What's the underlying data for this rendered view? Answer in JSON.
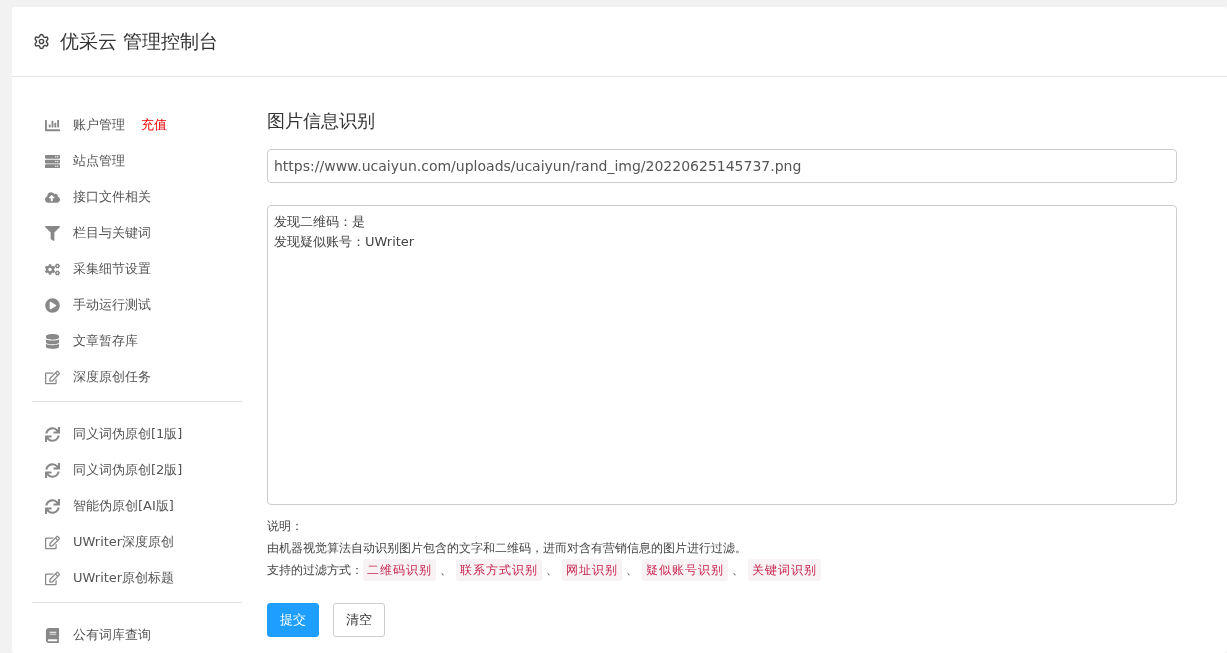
{
  "header": {
    "title": "优采云 管理控制台"
  },
  "sidebar": {
    "groups": [
      {
        "items": [
          {
            "kind": "chart",
            "label": "账户管理",
            "badge": "充值"
          },
          {
            "kind": "server",
            "label": "站点管理"
          },
          {
            "kind": "cloud",
            "label": "接口文件相关"
          },
          {
            "kind": "filter",
            "label": "栏目与关键词"
          },
          {
            "kind": "cogs",
            "label": "采集细节设置"
          },
          {
            "kind": "play",
            "label": "手动运行测试"
          },
          {
            "kind": "database",
            "label": "文章暂存库"
          },
          {
            "kind": "edit",
            "label": "深度原创任务"
          }
        ]
      },
      {
        "items": [
          {
            "kind": "sync",
            "label": "同义词伪原创[1版]"
          },
          {
            "kind": "sync",
            "label": "同义词伪原创[2版]"
          },
          {
            "kind": "sync",
            "label": "智能伪原创[AI版]"
          },
          {
            "kind": "edit",
            "label": "UWriter深度原创"
          },
          {
            "kind": "edit",
            "label": "UWriter原创标题"
          }
        ]
      },
      {
        "items": [
          {
            "kind": "book",
            "label": "公有词库查询"
          }
        ]
      }
    ]
  },
  "main": {
    "title": "图片信息识别",
    "url_field": {
      "value": "https://www.ucaiyun.com/uploads/ucaiyun/rand_img/20220625145737.png"
    },
    "result_box": {
      "lines": [
        "发现二维码：是",
        "发现疑似账号：UWriter"
      ]
    },
    "note_label": "说明：",
    "note_text": "由机器视觉算法自动识别图片包含的文字和二维码，进而对含有营销信息的图片进行过滤。",
    "methods_label": "支持的过滤方式：",
    "separator": "、",
    "methods": [
      "二维码识别",
      "联系方式识别",
      "网址识别",
      "疑似账号识别",
      "关键词识别"
    ],
    "buttons": [
      {
        "kind": "primary",
        "label": "提交"
      },
      {
        "kind": "default",
        "label": "清空"
      }
    ]
  }
}
